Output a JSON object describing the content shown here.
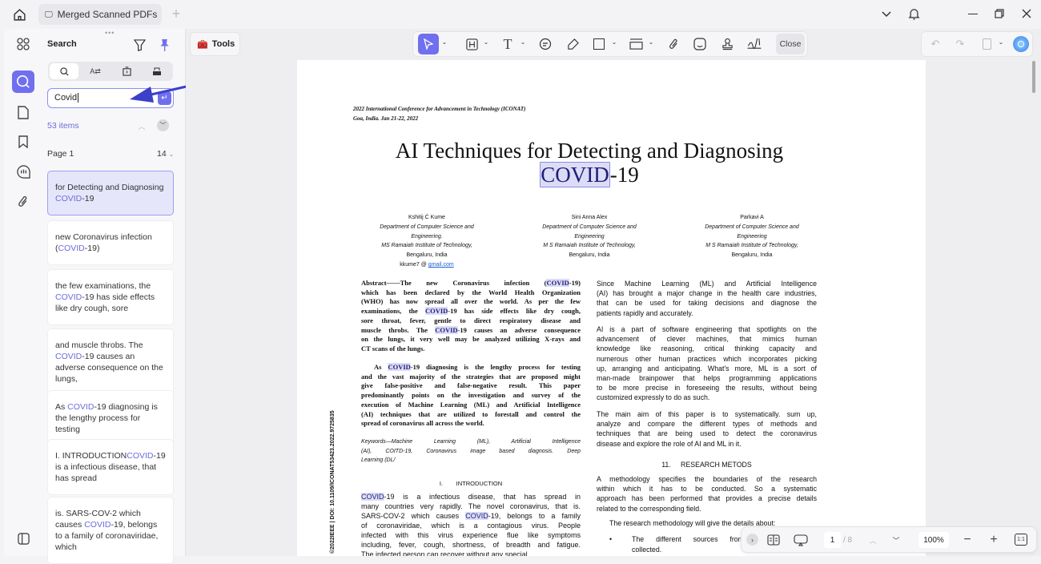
{
  "titlebar": {
    "tab_title": "Merged Scanned PDFs"
  },
  "search_panel": {
    "title": "Search",
    "query": "Covid",
    "result_count": "53 items",
    "page_label": "Page 1",
    "page_count": "14",
    "results": [
      "for Detecting and Diagnosing COVID-19",
      "new Coronavirus infection (COVID-19)",
      "the few examinations, the COVID-19 has side effects like dry cough, sore",
      "and muscle throbs. The COVID-19 causes an adverse consequence on the lungs,",
      "As COVID-19 diagnosing is the lengthy process for testing",
      "I. INTRODUCTIONCOVID-19 is a infectious disease, that has spread",
      "is. SARS-COV-2 which causes COVID-19, belongs to a family of coronaviridae, which"
    ]
  },
  "toolbar": {
    "tools_label": "Tools",
    "close_label": "Close"
  },
  "accent_color": "#6f6ff0",
  "bottom_bar": {
    "current_page": "1",
    "total_pages": "/ 8",
    "zoom": "100%"
  },
  "doc": {
    "conf_line1": "2022 International Conference for Advancement in Technology (ICONAT)",
    "conf_line2": "Goa, India. Jan 21-22, 2022",
    "title_line1": "AI Techniques for Detecting and Diagnosing",
    "title_hl": "COVID",
    "title_rest": "-19",
    "side_doi": "©2022IEEE | DOI: 10.1109/ICONAT53423.2022.9725835",
    "authors": [
      {
        "lines": [
          "Kshitij Ć Kume",
          "Department of Computer Science and",
          "Engineering.",
          "MS Ramaiah Institute of Technology,",
          "Bengaluru, India"
        ],
        "email_prefix": "kkume7 @ ",
        "email_link": "gmail.com"
      },
      {
        "lines": [
          "Sini Anna Alex",
          "Department of Computer Science and",
          "Engineering",
          "M S Ramaiah Institute of Technology,",
          "Bengaluru, India"
        ]
      },
      {
        "lines": [
          "Parkavi A",
          "Department of Computer Science and",
          "Engineering",
          "M S Ramaiah Institute of Technology,",
          "Bengaluru, India"
        ]
      }
    ],
    "abstract": [
      "Abstract——The new Coronavirus infection (COVID-19)",
      "which has been declared by the World Health Organization",
      "(WHO) has now spread all over the world. As per the few",
      "examinations, the COVID-19 has side effects like dry cough,",
      "sore throat, fever, gentle to direct respiratory disease and",
      "muscle throbs. The COVID-19 causes an adverse consequence",
      "on the lungs, it very well may be analyzed utilizing X-rays and",
      "CT scans of the lungs."
    ],
    "abstract2": [
      "As COVID-19 diagnosing is the lengthy process for testing",
      "and the vast majority of the strategies that are proposed might",
      "give false-positive and false-negative result. This paper",
      "predominantly points on the investigation and survey of the",
      "execution of Machine Learning (ML) and Artificial Intelligence",
      "(AI) techniques that are utilized to forestall and control the",
      "spread of coronavirus all across the world."
    ],
    "keywords": [
      "Keywords—Machine Learning (ML), Artificial Intelligence",
      "(AI), COITD-19, Coronavirus image based diagnosis. Deep",
      "Learning (DL/"
    ],
    "intro_heading": "I.        INTRODUCTION",
    "intro": [
      "COVID-19 is a infectious disease, that has spread in",
      "many countries very rapidly. The novel coronavirus, that is.",
      "SARS-COV-2 which causes COVID-19, belongs to a family",
      "of coronaviridae, which is a contagious virus. People",
      "infected with this virus experience flue like symptoms",
      "including, fever, cough, shortness, of breadth and fatigue.",
      "The infected person can recover without any special"
    ],
    "right_p1": [
      "Since Machine Learning (ML) and Artificial Intelligence",
      "(AI) has brought a major change in the health care industries,",
      "that can be used for taking decisions and diagnose the",
      "patients rapidly and accurately."
    ],
    "right_p2": [
      "AI is a part of software engineering that spotlights on the",
      "advancement of clever machines, that mimics human",
      "knowledge like reasoning, critical thinking capacity and",
      "numerous other human practices which incorporates picking",
      "up, arranging and anticipating. What's more, ML is a sort of",
      "man-made brainpower that helps programming applications",
      "to be more precise in foreseeing the results, without being",
      "customized expressly to do as such."
    ],
    "right_p3": [
      "The main aim of this paper is to systematically. sum up,",
      "analyze and compare the different types of methods and",
      "techniques that are being used to detect the coronavirus",
      "disease and explore the role of AI and ML in it."
    ],
    "methods_heading": "11.     RESEARCH METODS",
    "right_p4": [
      "A methodology specifies the boundaries of the research",
      "within which it has to be conducted. So a systematic",
      "approach has been performed that provides a precise details",
      "related to the corresponding field."
    ],
    "right_p5": [
      "The research methodology will give the details about:"
    ],
    "bullet": [
      "The different sources from",
      "collected."
    ]
  }
}
